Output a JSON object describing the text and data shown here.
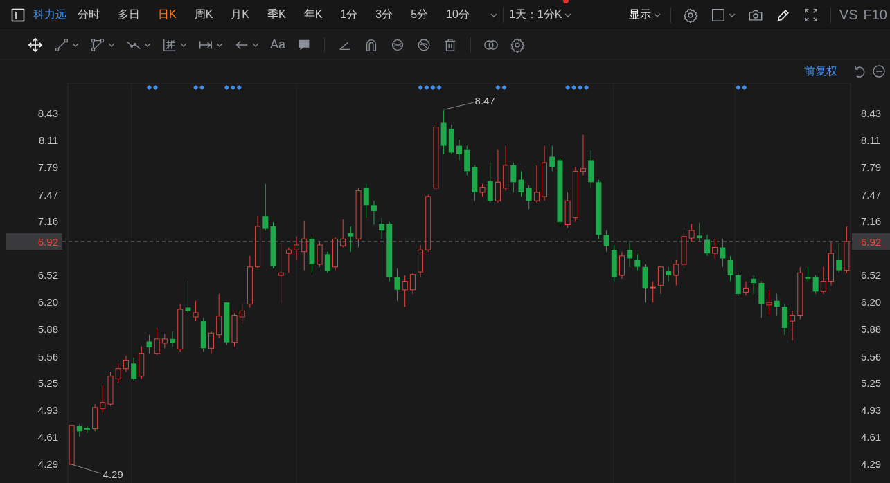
{
  "top_bar": {
    "stock_name": "科力远",
    "periods": [
      {
        "label": "分时",
        "selected": false
      },
      {
        "label": "多日",
        "selected": false
      },
      {
        "label": "日K",
        "selected": true
      },
      {
        "label": "周K",
        "selected": false
      },
      {
        "label": "月K",
        "selected": false
      },
      {
        "label": "季K",
        "selected": false
      },
      {
        "label": "年K",
        "selected": false
      },
      {
        "label": "1分",
        "selected": false
      },
      {
        "label": "3分",
        "selected": false
      },
      {
        "label": "5分",
        "selected": false
      },
      {
        "label": "10分",
        "selected": false
      }
    ],
    "interval_menu": {
      "label": "1天：1分K",
      "notification": true
    },
    "display_menu": "显示",
    "tools": [
      {
        "kind": "settings",
        "menu": false
      },
      {
        "kind": "square",
        "menu": true
      },
      {
        "kind": "camera",
        "menu": false
      },
      {
        "kind": "pencil",
        "menu": false
      },
      {
        "kind": "fullscreen",
        "menu": false
      }
    ],
    "vs": "VS",
    "f10": "F10"
  },
  "drawing_toolbar": {
    "groups": [
      [
        {
          "kind": "move",
          "menu": false
        },
        {
          "kind": "line",
          "menu": true
        },
        {
          "kind": "polygon",
          "menu": true
        },
        {
          "kind": "zigzag",
          "menu": true
        },
        {
          "kind": "fib",
          "menu": true
        },
        {
          "kind": "measure",
          "menu": true
        },
        {
          "kind": "arrow",
          "menu": true
        },
        {
          "kind": "text",
          "label": "Aa",
          "menu": false
        },
        {
          "kind": "comment",
          "menu": false
        }
      ],
      [
        {
          "kind": "angle",
          "menu": false
        },
        {
          "kind": "magnet",
          "menu": false
        },
        {
          "kind": "link",
          "menu": false
        },
        {
          "kind": "hide",
          "menu": false
        },
        {
          "kind": "trash",
          "menu": false
        }
      ],
      [
        {
          "kind": "compare",
          "menu": false
        },
        {
          "kind": "settings",
          "menu": false
        }
      ]
    ]
  },
  "chart_header": {
    "adjust": "前复权",
    "tools": [
      {
        "kind": "undo"
      },
      {
        "kind": "collapse"
      }
    ]
  },
  "current_price": {
    "left_tag": "6.92",
    "right_tag": "6.92"
  },
  "chart": {
    "chart_data": {
      "type": "candlestick",
      "ylim": [
        4.07,
        8.79
      ],
      "yticks": [
        {
          "value": 8.43,
          "label": "8.43"
        },
        {
          "value": 8.11,
          "label": "8.11"
        },
        {
          "value": 7.79,
          "label": "7.79"
        },
        {
          "value": 7.47,
          "label": "7.47"
        },
        {
          "value": 7.16,
          "label": "7.16"
        },
        {
          "value": 6.52,
          "label": "6.52"
        },
        {
          "value": 6.2,
          "label": "6.20"
        },
        {
          "value": 5.88,
          "label": "5.88"
        },
        {
          "value": 5.56,
          "label": "5.56"
        },
        {
          "value": 5.25,
          "label": "5.25"
        },
        {
          "value": 4.93,
          "label": "4.93"
        },
        {
          "value": 4.61,
          "label": "4.61"
        },
        {
          "value": 4.29,
          "label": "4.29"
        }
      ],
      "ohlc": [
        [
          4.29,
          4.75,
          4.29,
          4.75
        ],
        [
          4.74,
          4.76,
          4.62,
          4.68
        ],
        [
          4.72,
          4.74,
          4.66,
          4.7
        ],
        [
          4.71,
          5.0,
          4.68,
          4.96
        ],
        [
          4.95,
          5.22,
          4.9,
          5.02
        ],
        [
          5.0,
          5.38,
          4.98,
          5.33
        ],
        [
          5.3,
          5.48,
          5.25,
          5.42
        ],
        [
          5.42,
          5.57,
          5.38,
          5.52
        ],
        [
          5.48,
          5.55,
          5.28,
          5.3
        ],
        [
          5.33,
          5.68,
          5.3,
          5.6
        ],
        [
          5.74,
          5.82,
          5.6,
          5.67
        ],
        [
          5.6,
          5.9,
          5.58,
          5.77
        ],
        [
          5.72,
          5.83,
          5.66,
          5.77
        ],
        [
          5.77,
          5.86,
          5.68,
          5.72
        ],
        [
          5.65,
          6.18,
          5.62,
          6.12
        ],
        [
          6.14,
          6.45,
          6.08,
          6.1
        ],
        [
          6.03,
          6.22,
          5.98,
          6.08
        ],
        [
          5.98,
          6.02,
          5.62,
          5.66
        ],
        [
          5.66,
          5.86,
          5.6,
          5.84
        ],
        [
          5.82,
          6.3,
          5.78,
          6.04
        ],
        [
          6.2,
          6.2,
          5.7,
          5.73
        ],
        [
          5.73,
          6.07,
          5.68,
          6.05
        ],
        [
          6.03,
          6.18,
          5.95,
          6.1
        ],
        [
          6.18,
          6.75,
          6.14,
          6.62
        ],
        [
          6.62,
          7.22,
          6.6,
          7.1
        ],
        [
          7.22,
          7.6,
          7.05,
          7.07
        ],
        [
          7.1,
          7.15,
          6.6,
          6.63
        ],
        [
          6.52,
          6.9,
          6.18,
          6.55
        ],
        [
          6.78,
          6.85,
          6.55,
          6.82
        ],
        [
          6.82,
          6.98,
          6.7,
          6.88
        ],
        [
          6.8,
          7.16,
          6.58,
          6.95
        ],
        [
          6.95,
          6.98,
          6.55,
          6.65
        ],
        [
          6.65,
          6.92,
          6.62,
          6.88
        ],
        [
          6.77,
          6.8,
          6.55,
          6.57
        ],
        [
          6.62,
          6.97,
          6.58,
          6.95
        ],
        [
          6.87,
          7.18,
          6.85,
          6.95
        ],
        [
          7.02,
          7.1,
          6.8,
          6.98
        ],
        [
          6.95,
          7.55,
          6.85,
          7.52
        ],
        [
          7.55,
          7.6,
          7.2,
          7.35
        ],
        [
          7.35,
          7.4,
          7.12,
          7.28
        ],
        [
          7.13,
          7.2,
          6.95,
          7.05
        ],
        [
          7.13,
          7.15,
          6.45,
          6.5
        ],
        [
          6.5,
          6.6,
          6.22,
          6.35
        ],
        [
          6.35,
          6.52,
          6.15,
          6.45
        ],
        [
          6.35,
          6.55,
          6.3,
          6.53
        ],
        [
          6.56,
          6.88,
          6.5,
          6.82
        ],
        [
          6.82,
          7.47,
          6.8,
          7.45
        ],
        [
          7.55,
          8.3,
          7.52,
          8.27
        ],
        [
          8.32,
          8.47,
          7.95,
          8.05
        ],
        [
          8.25,
          8.3,
          7.95,
          7.97
        ],
        [
          8.05,
          8.12,
          7.88,
          7.95
        ],
        [
          8.0,
          8.05,
          7.7,
          7.75
        ],
        [
          7.8,
          7.82,
          7.4,
          7.5
        ],
        [
          7.5,
          7.6,
          7.45,
          7.56
        ],
        [
          7.63,
          7.85,
          7.38,
          7.4
        ],
        [
          7.4,
          8.0,
          7.38,
          7.62
        ],
        [
          7.55,
          8.05,
          7.52,
          7.82
        ],
        [
          7.82,
          7.85,
          7.5,
          7.62
        ],
        [
          7.65,
          7.75,
          7.45,
          7.5
        ],
        [
          7.55,
          7.58,
          7.3,
          7.4
        ],
        [
          7.4,
          7.82,
          7.38,
          7.5
        ],
        [
          7.45,
          8.05,
          7.4,
          7.85
        ],
        [
          7.92,
          8.05,
          7.75,
          7.8
        ],
        [
          7.88,
          7.9,
          7.12,
          7.15
        ],
        [
          7.12,
          7.5,
          7.08,
          7.4
        ],
        [
          7.2,
          7.8,
          7.15,
          7.75
        ],
        [
          7.75,
          8.18,
          7.7,
          7.78
        ],
        [
          7.88,
          8.0,
          7.55,
          7.62
        ],
        [
          7.62,
          7.65,
          6.95,
          7.0
        ],
        [
          7.0,
          7.05,
          6.8,
          6.87
        ],
        [
          6.82,
          6.88,
          6.45,
          6.5
        ],
        [
          6.52,
          6.8,
          6.48,
          6.75
        ],
        [
          6.82,
          6.93,
          6.62,
          6.72
        ],
        [
          6.7,
          6.77,
          6.58,
          6.62
        ],
        [
          6.62,
          6.65,
          6.2,
          6.37
        ],
        [
          6.38,
          6.45,
          6.2,
          6.38
        ],
        [
          6.4,
          6.62,
          6.3,
          6.62
        ],
        [
          6.57,
          6.62,
          6.45,
          6.52
        ],
        [
          6.52,
          6.7,
          6.4,
          6.65
        ],
        [
          6.65,
          7.08,
          6.6,
          6.98
        ],
        [
          6.96,
          7.13,
          6.92,
          7.05
        ],
        [
          6.99,
          7.14,
          6.92,
          6.96
        ],
        [
          6.94,
          7.0,
          6.75,
          6.78
        ],
        [
          6.78,
          6.95,
          6.72,
          6.85
        ],
        [
          6.85,
          6.95,
          6.62,
          6.72
        ],
        [
          6.7,
          6.75,
          6.45,
          6.52
        ],
        [
          6.52,
          6.55,
          6.28,
          6.3
        ],
        [
          6.32,
          6.45,
          6.28,
          6.37
        ],
        [
          6.48,
          6.52,
          6.3,
          6.43
        ],
        [
          6.43,
          6.45,
          6.02,
          6.18
        ],
        [
          6.17,
          6.35,
          6.05,
          6.2
        ],
        [
          6.22,
          6.3,
          6.05,
          6.15
        ],
        [
          6.15,
          6.18,
          5.82,
          5.9
        ],
        [
          5.98,
          6.1,
          5.75,
          6.05
        ],
        [
          6.05,
          6.62,
          6.0,
          6.55
        ],
        [
          6.5,
          6.62,
          6.45,
          6.48
        ],
        [
          6.5,
          6.52,
          6.3,
          6.33
        ],
        [
          6.33,
          6.62,
          6.3,
          6.45
        ],
        [
          6.45,
          6.92,
          6.4,
          6.78
        ],
        [
          6.7,
          6.9,
          6.55,
          6.58
        ],
        [
          6.58,
          7.1,
          6.55,
          6.92
        ]
      ],
      "annotations": [
        "8.47",
        "4.29"
      ]
    }
  }
}
